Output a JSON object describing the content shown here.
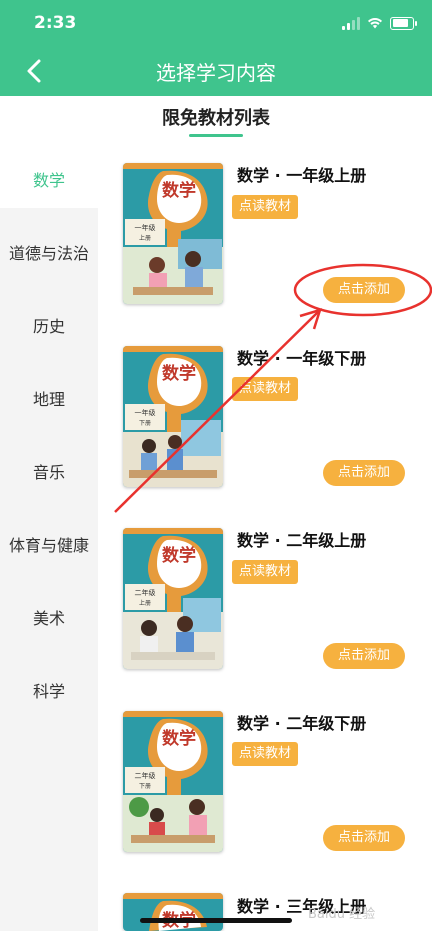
{
  "status_bar": {
    "time": "2:33"
  },
  "nav": {
    "title": "选择学习内容"
  },
  "subheader": {
    "title": "限免教材列表"
  },
  "sidebar": {
    "items": [
      {
        "label": "数学",
        "active": true
      },
      {
        "label": "道德与法治",
        "active": false
      },
      {
        "label": "历史",
        "active": false
      },
      {
        "label": "地理",
        "active": false
      },
      {
        "label": "音乐",
        "active": false
      },
      {
        "label": "体育与健康",
        "active": false
      },
      {
        "label": "美术",
        "active": false
      },
      {
        "label": "科学",
        "active": false
      }
    ]
  },
  "books": [
    {
      "title": "数学 · 一年级上册",
      "tag": "点读教材",
      "button": "点击添加",
      "cover_text": "数学",
      "cover_grade": "一年级",
      "cover_volume": "上册"
    },
    {
      "title": "数学 · 一年级下册",
      "tag": "点读教材",
      "button": "点击添加",
      "cover_text": "数学",
      "cover_grade": "一年级",
      "cover_volume": "下册"
    },
    {
      "title": "数学 · 二年级上册",
      "tag": "点读教材",
      "button": "点击添加",
      "cover_text": "数学",
      "cover_grade": "二年级",
      "cover_volume": "上册"
    },
    {
      "title": "数学 · 二年级下册",
      "tag": "点读教材",
      "button": "点击添加",
      "cover_text": "数学",
      "cover_grade": "二年级",
      "cover_volume": "下册"
    },
    {
      "title": "数学 · 三年级上册",
      "tag": "",
      "button": "",
      "cover_text": "数学",
      "cover_grade": "",
      "cover_volume": ""
    }
  ],
  "watermark": "Baidu 经验",
  "colors": {
    "primary": "#3fc48d",
    "accent": "#f6b13f",
    "annotation": "#e8322e"
  }
}
